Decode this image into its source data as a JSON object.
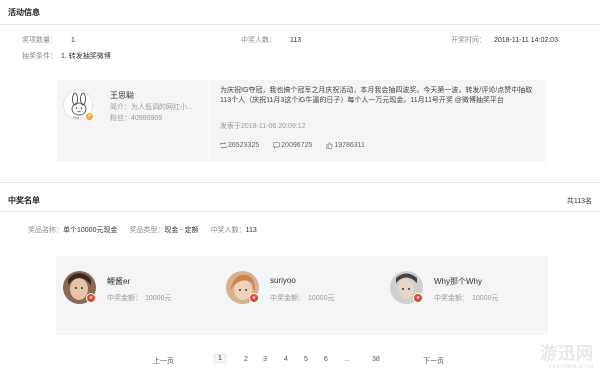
{
  "activity": {
    "title": "活动信息",
    "prize_count_label": "奖项数量：",
    "prize_count": "1",
    "winners_label": "中奖人数：",
    "winners": "113",
    "draw_time_label": "开奖时间：",
    "draw_time": "2018-11-11 14:02:03",
    "condition_label": "抽奖条件：",
    "condition": "1. 转发抽奖微博"
  },
  "post": {
    "user_name": "王思聪",
    "bio": "简介：为人低调的网红小...",
    "fans_label": "粉丝：",
    "fans": "40986909",
    "content": "为庆祝IG夺冠，我也搞个冠军之月庆祝活动，本月我会抽四波奖。今天第一波，转发/评论/点赞中抽取113个人（庆祝11月3这个iG牛逼的日子）每个人一万元现金。11月11号开奖 @微博抽奖平台",
    "published": "发表于2018-11-06 20:09:12",
    "reposts": "26523325",
    "comments": "20096725",
    "likes": "19786311"
  },
  "winners": {
    "title": "中奖名单",
    "total": "共113名",
    "prize_name_label": "奖品名称：",
    "prize_name": "单个10000元现金",
    "prize_type_label": "奖品类型：",
    "prize_type": "现金 - 定额",
    "count_label": "中奖人数：",
    "count": "113",
    "list": [
      {
        "name": "鲤酱er",
        "amount_label": "中奖金额：",
        "amount": "10000元"
      },
      {
        "name": "suriyoo",
        "amount_label": "中奖金额：",
        "amount": "10000元"
      },
      {
        "name": "Why那个Why",
        "amount_label": "中奖金额：",
        "amount": "10000元"
      }
    ]
  },
  "pagination": {
    "prev": "上一页",
    "pages": [
      "1",
      "2",
      "3",
      "4",
      "5",
      "6",
      "...",
      "38"
    ],
    "next": "下一页",
    "current": "1"
  },
  "watermark": {
    "main": "游迅网",
    "sub": "YXDOWN.COM"
  },
  "colors": {
    "card_bg": "#f4f5f7",
    "badge_verified": "#f5a623",
    "badge_red": "#e0462f"
  }
}
